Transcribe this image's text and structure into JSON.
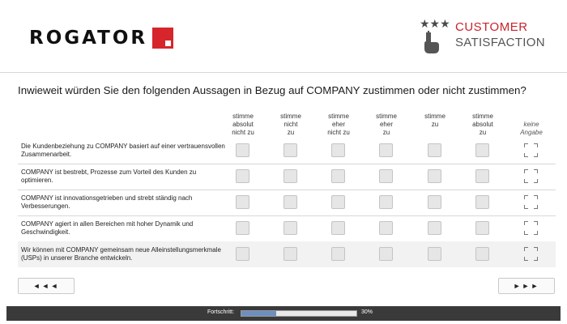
{
  "header": {
    "logo_text": "ROGATOR",
    "badge_line1": "CUSTOMER",
    "badge_line2": "SATISFACTION",
    "stars_glyphs": "★★★"
  },
  "question": "Inwieweit würden Sie den folgenden Aussagen in Bezug auf COMPANY zustimmen oder nicht zustimmen?",
  "columns": [
    {
      "label": "stimme\nabsolut\nnicht zu"
    },
    {
      "label": "stimme\nnicht\nzu"
    },
    {
      "label": "stimme\neher\nnicht zu"
    },
    {
      "label": "stimme\neher\nzu"
    },
    {
      "label": "stimme\nzu"
    },
    {
      "label": "stimme\nabsolut\nzu"
    },
    {
      "label": "keine\nAngabe"
    }
  ],
  "rows": [
    {
      "label": "Die Kundenbeziehung zu COMPANY basiert auf einer vertrauensvollen Zusammenarbeit."
    },
    {
      "label": "COMPANY ist bestrebt, Prozesse zum Vorteil des Kunden zu optimieren."
    },
    {
      "label": "COMPANY ist innovationsgetrieben und strebt ständig nach Verbesserungen."
    },
    {
      "label": "COMPANY agiert in allen Bereichen mit hoher Dynamik und Geschwindigkeit."
    },
    {
      "label": "Wir können mit COMPANY gemeinsam neue Alleinstellungsmerkmale (USPs) in unserer Branche entwickeln."
    }
  ],
  "nav": {
    "back_label": "◄◄◄",
    "next_label": "►►►"
  },
  "progress": {
    "label": "Fortschritt:",
    "percent_text": "30%",
    "value": 0.3
  },
  "colors": {
    "brand_red": "#d6262c",
    "footer_bg": "#3a3a3a",
    "progress_fill": "#6d8fc0"
  }
}
